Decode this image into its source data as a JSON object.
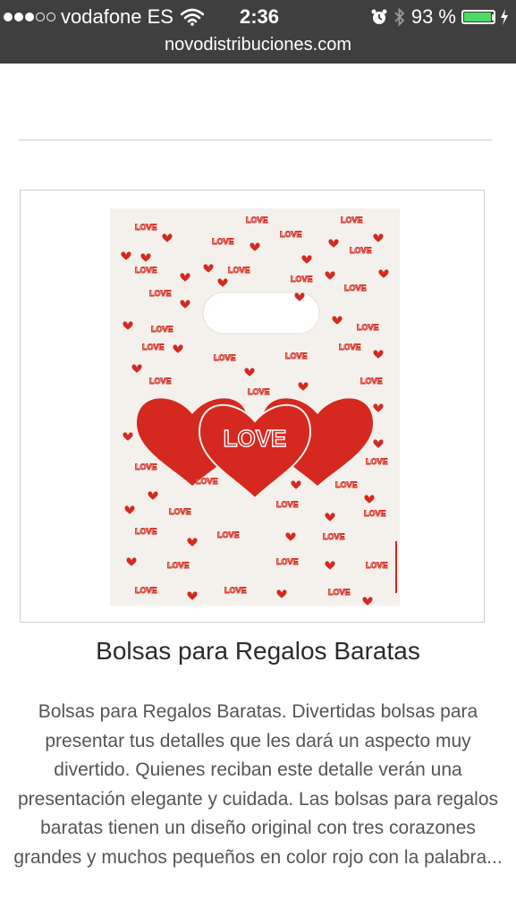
{
  "status_bar": {
    "carrier": "vodafone ES",
    "time": "2:36",
    "battery_percent": "93 %",
    "battery_level": 0.93,
    "signal_bars": 3,
    "icons": [
      "signal-icon",
      "wifi-icon",
      "alarm-icon",
      "bluetooth-icon",
      "battery-icon",
      "charging-icon"
    ]
  },
  "browser": {
    "url": "novodistribuciones.com"
  },
  "product": {
    "image_text": "LOVE",
    "title": "Bolsas para Regalos Baratas",
    "description": "Bolsas para Regalos Baratas. Divertidas bolsas para presentar tus detalles que les dará un aspecto muy divertido. Quienes reciban este detalle verán una presentación elegante y cuidada. Las bolsas para regalos baratas tienen un diseño original con tres corazones grandes y muchos pequeños en color rojo con la palabra..."
  },
  "colors": {
    "status_bg": "#3f3f3f",
    "battery_green": "#4cd964",
    "heart_red": "#d5281f",
    "bag_bg": "#f4f1ec"
  }
}
